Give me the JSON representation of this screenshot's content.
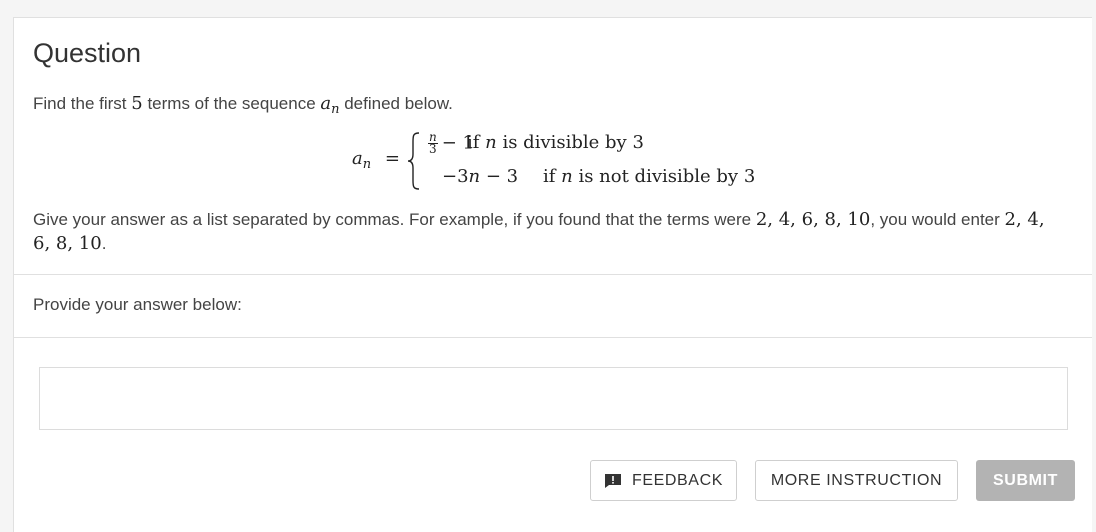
{
  "question": {
    "title": "Question",
    "intro_prefix": "Find the first ",
    "intro_count": "5",
    "intro_middle": " terms of the sequence ",
    "seq_var": "a",
    "seq_sub": "n",
    "intro_suffix": " defined below."
  },
  "formula": {
    "lhs_var": "a",
    "lhs_sub": "n",
    "equals": "=",
    "case1_num": "n",
    "case1_den": "3",
    "case1_rest": "− 1",
    "case1_cond_if": "if ",
    "case1_cond_var": "n",
    "case1_cond_rest": " is divisible by 3",
    "case2_expr_pre": "−3",
    "case2_expr_var": "n",
    "case2_expr_post": " − 3",
    "case2_cond_if": "if ",
    "case2_cond_var": "n",
    "case2_cond_rest": " is not divisible by 3"
  },
  "instructions": {
    "text_before": "Give your answer as a list separated by commas. For example, if you found that the terms were ",
    "example_1": "2, 4, 6, 8, 10",
    "text_middle": ", you would enter ",
    "example_2": "2, 4, 6, 8, 10",
    "text_after": "."
  },
  "answer": {
    "label": "Provide your answer below:",
    "value": "",
    "placeholder": ""
  },
  "buttons": {
    "feedback": "FEEDBACK",
    "more_instruction": "MORE INSTRUCTION",
    "submit": "SUBMIT"
  },
  "icons": {
    "feedback": "feedback-icon"
  },
  "colors": {
    "submit_bg": "#b3b3b3",
    "border": "#e0e0e0",
    "text": "#333333"
  }
}
